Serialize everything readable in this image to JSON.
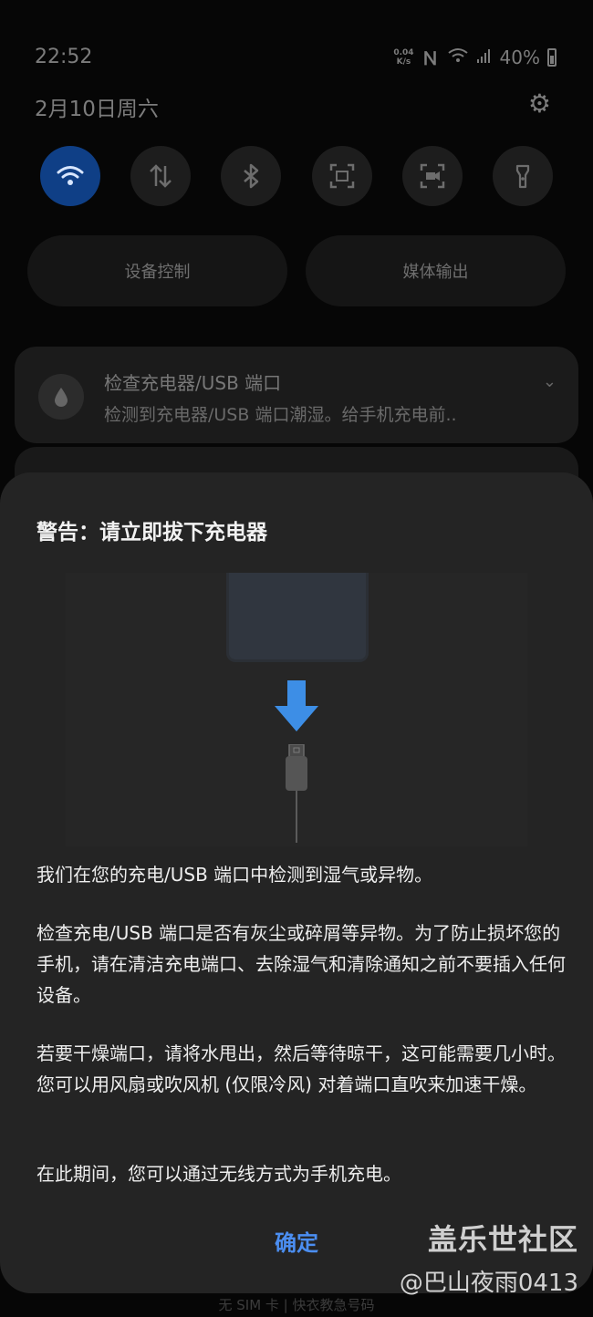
{
  "status_bar": {
    "time": "22:52",
    "net_speed_value": "0.04",
    "net_speed_unit": "K/s",
    "battery": "40%"
  },
  "shade": {
    "date": "2月10日周六",
    "tiles": [
      {
        "icon": "wifi-icon",
        "active": true
      },
      {
        "icon": "mobile-data-icon",
        "active": false
      },
      {
        "icon": "bluetooth-icon",
        "active": false
      },
      {
        "icon": "screenshot-icon",
        "active": false
      },
      {
        "icon": "screen-record-icon",
        "active": false
      },
      {
        "icon": "flashlight-icon",
        "active": false
      }
    ],
    "device_control": "设备控制",
    "media_output": "媒体输出",
    "notification": {
      "title": "检查充电器/USB 端口",
      "text": "检测到充电器/USB 端口潮湿。给手机充电前.."
    }
  },
  "dialog": {
    "title": "警告：请立即拔下充电器",
    "paragraphs": [
      "我们在您的充电/USB 端口中检测到湿气或异物。",
      "检查充电/USB 端口是否有灰尘或碎屑等异物。为了防止损坏您的手机，请在清洁充电端口、去除湿气和清除通知之前不要插入任何设备。",
      "若要干燥端口，请将水甩出，然后等待晾干，这可能需要几小时。您可以用风扇或吹风机 (仅限冷风) 对着端口直吹来加速干燥。",
      "在此期间，您可以通过无线方式为手机充电。"
    ],
    "ok_label": "确定"
  },
  "bottom_text": "无 SIM 卡 | 快衣教急号码",
  "watermark": {
    "line1": "盖乐世社区",
    "line2": "@巴山夜雨0413"
  },
  "colors": {
    "accent": "#4b8ef1",
    "dialog_bg": "#242424",
    "arrow": "#3d8ee6"
  }
}
